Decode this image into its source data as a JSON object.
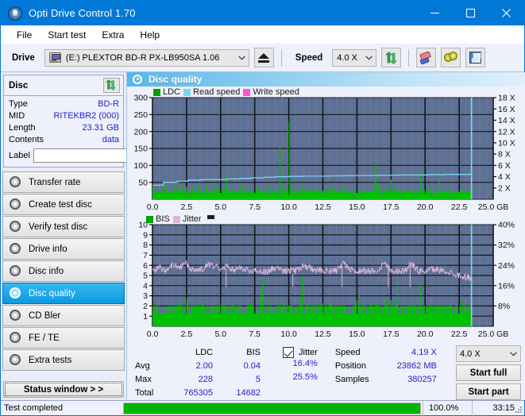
{
  "window": {
    "title": "Opti Drive Control 1.70",
    "app_icon": "disc-icon",
    "minimize": "minimize-icon",
    "maximize": "maximize-icon",
    "close": "close-icon"
  },
  "menu": [
    {
      "label": "File"
    },
    {
      "label": "Start test"
    },
    {
      "label": "Extra"
    },
    {
      "label": "Help"
    }
  ],
  "toolbar": {
    "drive_label": "Drive",
    "drive_value": "(E:)  PLEXTOR BD-R  PX-LB950SA 1.06",
    "eject_icon": "eject-icon",
    "speed_label": "Speed",
    "speed_value": "4.0 X",
    "refresh_icon": "refresh-icon",
    "erase_icon": "eraser-icon",
    "discs_icon": "two-discs-icon",
    "save_icon": "floppy-save-icon"
  },
  "disc_panel": {
    "title": "Disc",
    "refresh_icon": "refresh-icon",
    "rows": [
      {
        "key": "Type",
        "value": "BD-R"
      },
      {
        "key": "MID",
        "value": "RITEKBR2 (000)"
      },
      {
        "key": "Length",
        "value": "23.31 GB"
      },
      {
        "key": "Contents",
        "value": "data"
      }
    ],
    "label_key": "Label",
    "label_value": "",
    "label_placeholder": "",
    "disc_button_icon": "disc-icon"
  },
  "nav": {
    "items": [
      {
        "label": "Transfer rate",
        "icon": "disc-transfer-icon",
        "active": false
      },
      {
        "label": "Create test disc",
        "icon": "disc-create-icon",
        "active": false
      },
      {
        "label": "Verify test disc",
        "icon": "disc-verify-icon",
        "active": false
      },
      {
        "label": "Drive info",
        "icon": "disc-drive-icon",
        "active": false
      },
      {
        "label": "Disc info",
        "icon": "disc-info-icon",
        "active": false
      },
      {
        "label": "Disc quality",
        "icon": "disc-quality-icon",
        "active": true
      },
      {
        "label": "CD Bler",
        "icon": "disc-bler-icon",
        "active": false
      },
      {
        "label": "FE / TE",
        "icon": "disc-fete-icon",
        "active": false
      },
      {
        "label": "Extra tests",
        "icon": "disc-extra-icon",
        "active": false
      }
    ],
    "status_window": "Status window > >"
  },
  "main": {
    "header_title": "Disc quality",
    "header_icon": "disc-quality-icon"
  },
  "stats": {
    "col_headers": [
      "",
      "LDC",
      "BIS"
    ],
    "rows": [
      {
        "key": "Avg",
        "ldc": "2.00",
        "bis": "0.04",
        "jitter": "16.4%"
      },
      {
        "key": "Max",
        "ldc": "228",
        "bis": "5",
        "jitter": "25.5%"
      },
      {
        "key": "Total",
        "ldc": "765305",
        "bis": "14682",
        "jitter": ""
      }
    ],
    "jitter_label": "Jitter",
    "jitter_checked": true,
    "speed_key": "Speed",
    "speed_value": "4.19 X",
    "position_key": "Position",
    "position_value": "23862 MB",
    "samples_key": "Samples",
    "samples_value": "380257",
    "speed_select": "4.0 X",
    "start_full": "Start full",
    "start_part": "Start part"
  },
  "statusbar": {
    "text": "Test completed",
    "progress": 100,
    "percent": "100.0%",
    "time": "33:15"
  },
  "colors": {
    "accent": "#0078d7",
    "plot_bg": "#5e7195",
    "grid": "#262a33",
    "ldc_green": "#00c000",
    "read_speed": "#7fd4f2",
    "write_speed": "#ff4fd8",
    "jitter_pink": "#e0b4da",
    "value_blue": "#2323c8",
    "progress_green": "#00b500"
  },
  "chart_data": [
    {
      "type": "line",
      "name": "disc-quality-ldc-chart",
      "title": "",
      "xlabel": "GB",
      "ylabel": "",
      "xlim": [
        0,
        25
      ],
      "ylim": [
        0,
        300
      ],
      "y2lim": [
        0,
        18
      ],
      "y2label": "X",
      "grid": true,
      "legend": [
        "LDC",
        "Read speed",
        "Write speed"
      ],
      "legend_position": "top-left",
      "xticks": [
        "0.0",
        "2.5",
        "5.0",
        "7.5",
        "10.0",
        "12.5",
        "15.0",
        "17.5",
        "20.0",
        "22.5",
        "25.0 GB"
      ],
      "yticks": [
        50,
        100,
        150,
        200,
        250,
        300
      ],
      "y2ticks": [
        "2 X",
        "4 X",
        "6 X",
        "8 X",
        "10 X",
        "12 X",
        "14 X",
        "16 X",
        "18 X"
      ],
      "data_end_gb": 23.4,
      "series": [
        {
          "name": "LDC",
          "color": "#00c000",
          "type": "spike",
          "baseline": 8,
          "x": [
            0.05,
            0.2,
            0.35,
            0.5,
            0.7,
            0.9,
            1.05,
            1.2,
            1.4,
            1.55,
            1.75,
            1.95,
            2.1,
            2.3,
            2.5,
            2.7,
            2.9,
            3.05,
            3.25,
            3.45,
            3.6,
            3.8,
            4.0,
            4.2,
            4.35,
            4.55,
            4.75,
            4.9,
            5.1,
            5.3,
            5.45,
            5.6,
            5.75,
            5.95,
            6.15,
            6.35,
            6.5,
            6.7,
            6.9,
            7.05,
            7.25,
            7.45,
            7.6,
            7.8,
            8.0,
            8.2,
            8.4,
            8.55,
            8.75,
            8.95,
            9.15,
            9.35,
            9.5,
            9.7,
            9.85,
            9.95,
            10.1,
            10.3,
            10.45,
            10.6,
            10.8,
            11.0,
            11.2,
            11.4,
            11.6,
            11.8,
            12.0,
            12.2,
            12.4,
            12.6,
            12.8,
            13.0,
            13.2,
            13.4,
            13.6,
            13.8,
            14.0,
            14.2,
            14.4,
            14.6,
            14.8,
            15.0,
            15.2,
            15.4,
            15.6,
            15.8,
            16.0,
            16.2,
            16.4,
            16.6,
            16.8,
            17.0,
            17.15,
            17.3,
            17.5,
            17.7,
            17.9,
            18.1,
            18.3,
            18.5,
            18.7,
            18.9,
            19.1,
            19.3,
            19.5,
            19.7,
            19.9,
            20.1,
            20.25,
            20.45,
            20.65,
            20.85,
            21.05,
            21.25,
            21.4,
            21.6,
            21.8,
            22.0,
            22.2,
            22.4,
            22.6,
            22.8,
            23.0,
            23.2,
            23.35
          ],
          "y": [
            22,
            30,
            18,
            26,
            34,
            20,
            45,
            18,
            24,
            30,
            16,
            52,
            22,
            18,
            36,
            24,
            20,
            30,
            18,
            44,
            22,
            16,
            48,
            20,
            30,
            18,
            25,
            38,
            22,
            16,
            76,
            28,
            20,
            34,
            18,
            24,
            48,
            20,
            16,
            30,
            22,
            18,
            40,
            24,
            16,
            26,
            32,
            18,
            22,
            30,
            20,
            152,
            44,
            18,
            26,
            230,
            38,
            20,
            30,
            18,
            24,
            42,
            20,
            16,
            28,
            22,
            18,
            30,
            24,
            16,
            26,
            20,
            18,
            34,
            22,
            16,
            28,
            20,
            18,
            24,
            22,
            16,
            30,
            20,
            18,
            26,
            22,
            16,
            105,
            36,
            20,
            28,
            18,
            24,
            58,
            22,
            16,
            30,
            20,
            18,
            26,
            22,
            16,
            30,
            20,
            88,
            26,
            18,
            24,
            30,
            20,
            16,
            62,
            22,
            18,
            26,
            20,
            16,
            24,
            18,
            22,
            16,
            20,
            14,
            10
          ]
        },
        {
          "name": "Read speed",
          "color": "#7fd4f2",
          "type": "step",
          "x": [
            0.0,
            0.8,
            1.8,
            2.6,
            3.6,
            4.6,
            5.4,
            6.4,
            7.2,
            8.2,
            9.0,
            10.0,
            11.0,
            12.0,
            13.0,
            14.2,
            15.4,
            16.6,
            17.8,
            19.0,
            20.2,
            21.4,
            22.6,
            23.4
          ],
          "y_speed_x": [
            2.5,
            3.0,
            3.2,
            3.4,
            3.5,
            3.5,
            3.6,
            3.7,
            3.8,
            3.9,
            4.0,
            4.05,
            4.1,
            4.1,
            4.15,
            4.2,
            4.2,
            4.25,
            4.3,
            4.3,
            4.35,
            4.4,
            4.4,
            4.4
          ]
        },
        {
          "name": "Write speed",
          "color": "#ff4fd8",
          "type": "line",
          "x": [],
          "y": []
        }
      ]
    },
    {
      "type": "line",
      "name": "disc-quality-bis-jitter-chart",
      "title": "",
      "xlabel": "GB",
      "ylabel": "",
      "xlim": [
        0,
        25
      ],
      "ylim": [
        0,
        10
      ],
      "y2lim": [
        0,
        40
      ],
      "y2label": "%",
      "grid": true,
      "legend": [
        "BIS",
        "Jitter"
      ],
      "legend_position": "top-left",
      "xticks": [
        "0.0",
        "2.5",
        "5.0",
        "7.5",
        "10.0",
        "12.5",
        "15.0",
        "17.5",
        "20.0",
        "22.5",
        "25.0 GB"
      ],
      "yticks": [
        1,
        2,
        3,
        4,
        5,
        6,
        7,
        8,
        9,
        10
      ],
      "y2ticks": [
        "8%",
        "16%",
        "24%",
        "32%",
        "40%"
      ],
      "data_end_gb": 23.4,
      "series": [
        {
          "name": "BIS",
          "color": "#00c000",
          "type": "spike",
          "baseline": 1.0,
          "avg": 0.04,
          "max": 5,
          "total": 14682
        },
        {
          "name": "Jitter",
          "color": "#e0b4da",
          "type": "line",
          "avg_pct": 16.4,
          "max_pct": 25.5,
          "x": [
            0.0,
            0.5,
            1.0,
            1.5,
            2.0,
            2.5,
            3.0,
            3.5,
            4.0,
            4.5,
            5.0,
            5.5,
            6.0,
            6.5,
            7.0,
            7.5,
            8.0,
            8.5,
            9.0,
            9.5,
            10.0,
            10.5,
            11.0,
            11.5,
            12.0,
            12.5,
            13.0,
            13.5,
            14.0,
            14.5,
            15.0,
            15.5,
            16.0,
            16.5,
            17.0,
            17.5,
            18.0,
            18.5,
            19.0,
            19.5,
            20.0,
            20.5,
            21.0,
            21.5,
            22.0,
            22.5,
            23.0,
            23.4
          ],
          "y_pct": [
            16.0,
            19.5,
            18.0,
            22.0,
            20.5,
            23.0,
            17.5,
            17.0,
            22.5,
            21.5,
            19.0,
            22.0,
            17.5,
            20.0,
            16.5,
            17.0,
            16.5,
            16.0,
            20.5,
            16.5,
            17.5,
            16.0,
            21.0,
            19.5,
            16.5,
            17.5,
            16.0,
            16.5,
            24.0,
            17.0,
            16.5,
            17.0,
            16.5,
            17.0,
            24.5,
            17.0,
            16.5,
            16.5,
            24.0,
            16.0,
            16.5,
            18.0,
            17.5,
            16.5,
            15.5,
            14.5,
            14.0,
            14.5
          ]
        }
      ]
    }
  ]
}
